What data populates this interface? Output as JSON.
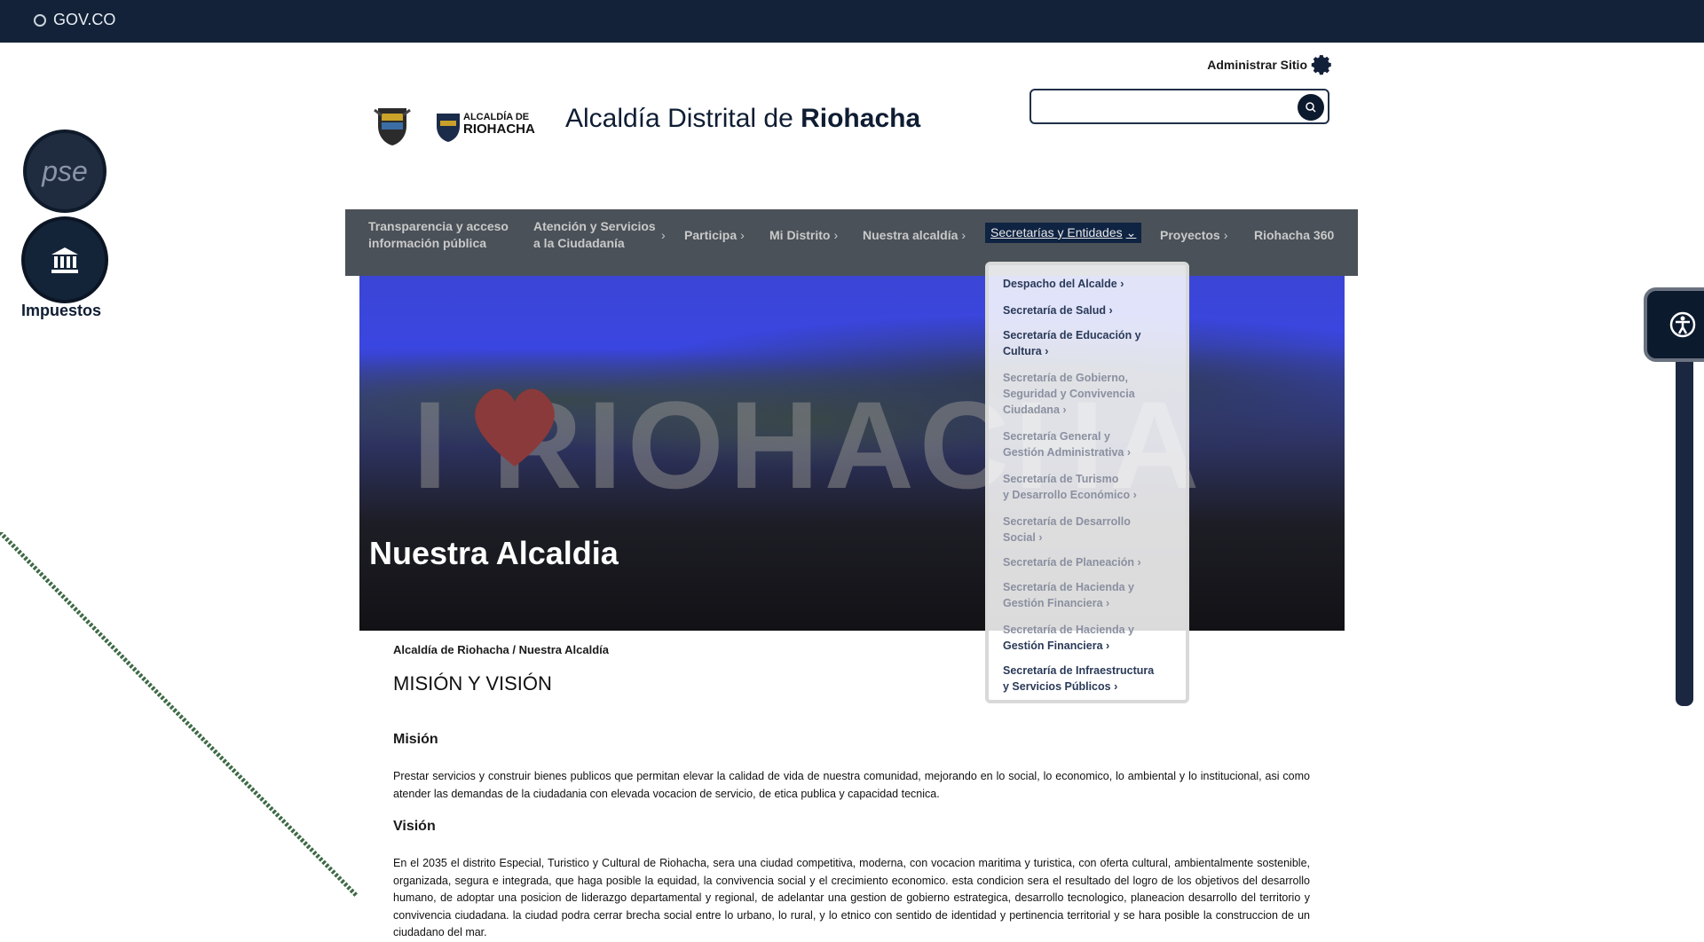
{
  "govbar": {
    "label": "GOV.CO"
  },
  "admin": {
    "label": "Administrar Sitio"
  },
  "header": {
    "title_prefix": "Alcaldía Distrital de ",
    "title_bold": "Riohacha",
    "logo_text_line1": "ALCALDÍA DE",
    "logo_text_line2": "RIOHACHA"
  },
  "search": {
    "placeholder": ""
  },
  "left_buttons": {
    "pse_label": "pse",
    "tax_label": "Impuestos"
  },
  "nav": {
    "items": [
      {
        "label_line1": "Transparencia y acceso",
        "label_line2": "información pública"
      },
      {
        "label_line1": "Atención y Servicios",
        "label_line2": "a la Ciudadanía"
      },
      {
        "label": "Participa"
      },
      {
        "label": "Mi Distrito"
      },
      {
        "label": "Nuestra alcaldía"
      },
      {
        "label": "Secretarías y Entidades"
      },
      {
        "label": "Proyectos"
      },
      {
        "label": "Riohacha 360"
      }
    ]
  },
  "hero": {
    "title": "Nuestra Alcaldia",
    "sign_text": "I RIOHACHA"
  },
  "dropdown": {
    "items": [
      {
        "line1": "Despacho del Alcalde",
        "line2": ""
      },
      {
        "line1": "Secretaría de Salud",
        "line2": ""
      },
      {
        "line1": "Secretaría de Educación y",
        "line2": "Cultura"
      },
      {
        "line1": "Secretaría de Gobierno,",
        "line2": "Seguridad y Convivencia",
        "line3": "Ciudadana"
      },
      {
        "line1": "Secretaría General y",
        "line2": "Gestión Administrativa"
      },
      {
        "line1": "Secretaría de Turismo",
        "line2": "y Desarrollo Económico"
      },
      {
        "line1": "Secretaría de Desarrollo",
        "line2": "Social"
      },
      {
        "line1": "Secretaría de Planeación",
        "line2": ""
      },
      {
        "line1": "Secretaría de Hacienda y",
        "line2": "Gestión Financiera"
      },
      {
        "line1": "Secretaría de Hacienda y",
        "line2": "Gestión Financiera"
      },
      {
        "line1": "Secretaría de Infraestructura",
        "line2": "y Servicios Públicos"
      }
    ]
  },
  "content": {
    "breadcrumb": "Alcaldía de Riohacha / Nuestra Alcaldía",
    "heading": "MISIÓN Y VISIÓN",
    "mision_title": "Misión",
    "mision_text": "Prestar servicios y construir bienes publicos que permitan elevar la calidad de vida de nuestra comunidad, mejorando en lo social, lo economico, lo ambiental y lo institucional, asi como atender las demandas de la ciudadania con elevada vocacion de servicio, de etica publica y capacidad tecnica.",
    "vision_title": "Visión",
    "vision_text": "En el 2035 el distrito Especial, Turistico y Cultural de Riohacha, sera una ciudad competitiva, moderna, con vocacion maritima y turistica, con oferta cultural, ambientalmente sostenible, organizada, segura e integrada, que haga posible la equidad, la convivencia social y el crecimiento economico.  esta condicion sera el resultado del logro de los objetivos del desarrollo humano, de adoptar una posicion de liderazgo departamental y regional, de adelantar una gestion de gobierno estrategica, desarrollo tecnologico, planeacion desarrollo del territorio y convivencia ciudadana. la ciudad podra cerrar brecha social entre lo urbano, lo rural, y lo etnico con sentido de identidad y pertinencia territorial y se hara posible la construccion de un ciudadano del mar."
  },
  "colors": {
    "govbar": "#132238",
    "nav": "#4a5158",
    "accent": "#0f2342"
  }
}
